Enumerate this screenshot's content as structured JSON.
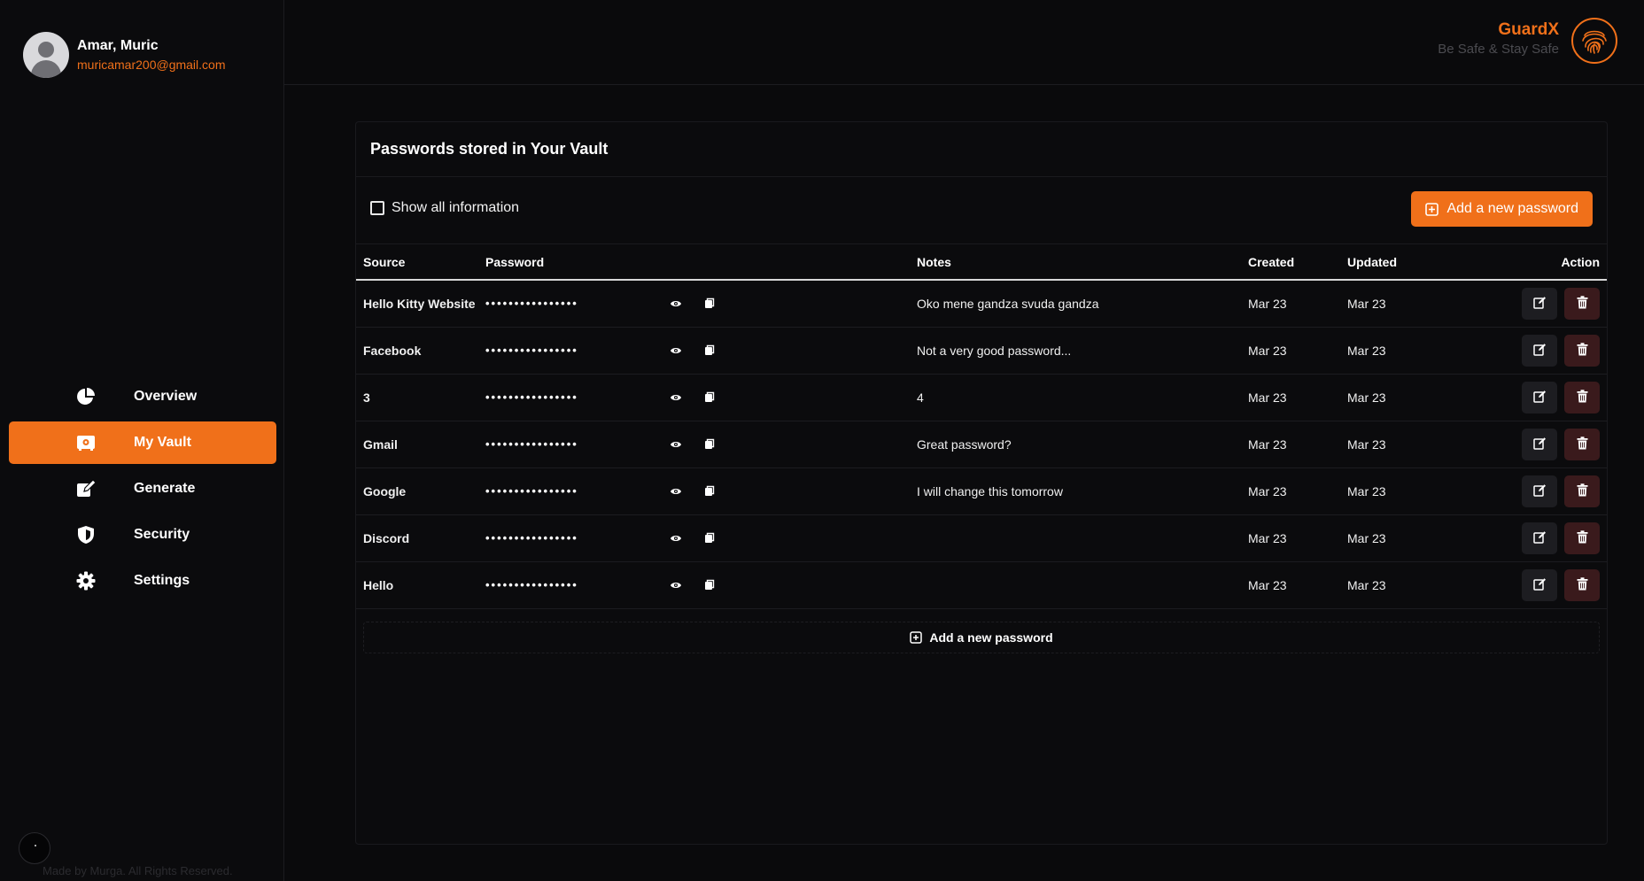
{
  "user": {
    "name": "Amar, Muric",
    "email": "muricamar200@gmail.com"
  },
  "brand": {
    "name": "GuardX",
    "tagline": "Be Safe & Stay Safe",
    "accent": "#f0701a"
  },
  "nav": {
    "items": [
      {
        "label": "Overview",
        "icon": "pie-chart-icon",
        "active": false
      },
      {
        "label": "My Vault",
        "icon": "vault-icon",
        "active": true
      },
      {
        "label": "Generate",
        "icon": "edit-square-icon",
        "active": false
      },
      {
        "label": "Security",
        "icon": "shield-icon",
        "active": false
      },
      {
        "label": "Settings",
        "icon": "gear-icon",
        "active": false
      }
    ]
  },
  "footer": {
    "note": "Made by Murga. All Rights Reserved."
  },
  "vault": {
    "title": "Passwords stored in Your Vault",
    "show_all_label": "Show all information",
    "add_button_label": "Add a new password",
    "columns": {
      "source": "Source",
      "password": "Password",
      "notes": "Notes",
      "created": "Created",
      "updated": "Updated",
      "action": "Action"
    },
    "masked_password": "••••••••••••••••",
    "rows": [
      {
        "source": "Hello Kitty Website",
        "notes": "Oko mene gandza svuda gandza",
        "created": "Mar 23",
        "updated": "Mar 23"
      },
      {
        "source": "Facebook",
        "notes": "Not a very good password...",
        "created": "Mar 23",
        "updated": "Mar 23"
      },
      {
        "source": "3",
        "notes": "4",
        "created": "Mar 23",
        "updated": "Mar 23"
      },
      {
        "source": "Gmail",
        "notes": "Great password?",
        "created": "Mar 23",
        "updated": "Mar 23"
      },
      {
        "source": "Google",
        "notes": "I will change this tomorrow",
        "created": "Mar 23",
        "updated": "Mar 23"
      },
      {
        "source": "Discord",
        "notes": "",
        "created": "Mar 23",
        "updated": "Mar 23"
      },
      {
        "source": "Hello",
        "notes": "",
        "created": "Mar 23",
        "updated": "Mar 23"
      }
    ],
    "add_row_label": "Add a new password"
  }
}
